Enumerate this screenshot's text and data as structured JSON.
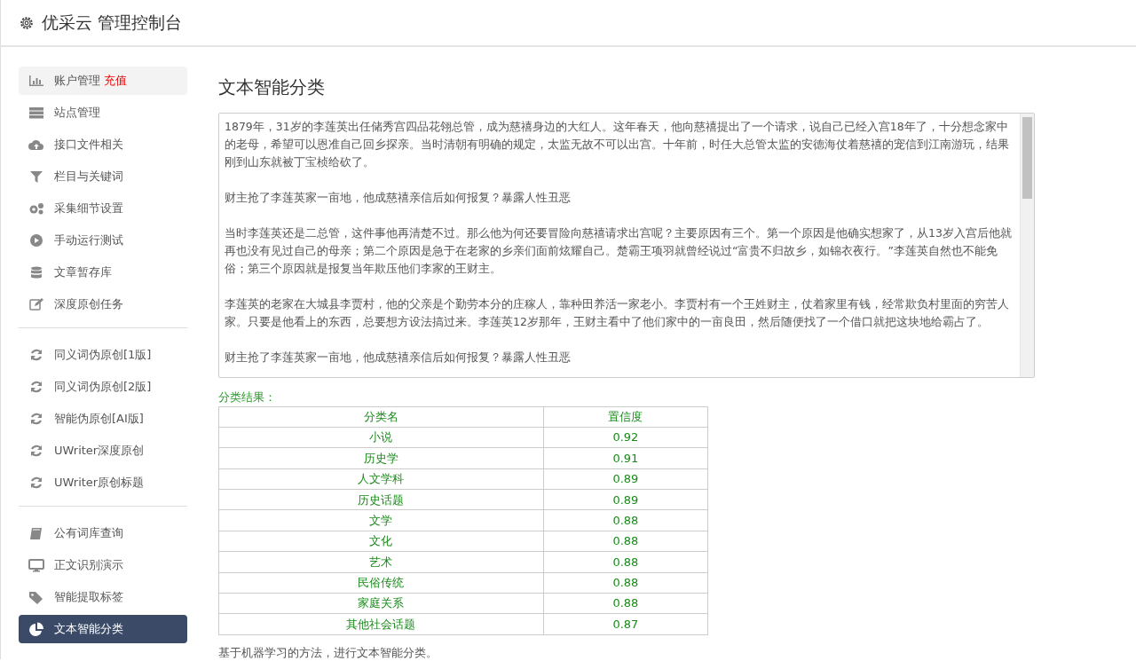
{
  "header": {
    "title": "优采云 管理控制台"
  },
  "sidebar": {
    "groups": [
      [
        {
          "label": "账户管理",
          "tag": "充值",
          "selected": false,
          "hovered": true
        },
        {
          "label": "站点管理",
          "selected": false,
          "hovered": false
        },
        {
          "label": "接口文件相关",
          "selected": false,
          "hovered": false
        },
        {
          "label": "栏目与关键词",
          "selected": false,
          "hovered": false
        },
        {
          "label": "采集细节设置",
          "selected": false,
          "hovered": false
        },
        {
          "label": "手动运行测试",
          "selected": false,
          "hovered": false
        },
        {
          "label": "文章暂存库",
          "selected": false,
          "hovered": false
        },
        {
          "label": "深度原创任务",
          "selected": false,
          "hovered": false
        }
      ],
      [
        {
          "label": "同义词伪原创[1版]",
          "selected": false,
          "hovered": false
        },
        {
          "label": "同义词伪原创[2版]",
          "selected": false,
          "hovered": false
        },
        {
          "label": "智能伪原创[AI版]",
          "selected": false,
          "hovered": false
        },
        {
          "label": "UWriter深度原创",
          "selected": false,
          "hovered": false
        },
        {
          "label": "UWriter原创标题",
          "selected": false,
          "hovered": false
        }
      ],
      [
        {
          "label": "公有词库查询",
          "selected": false,
          "hovered": false
        },
        {
          "label": "正文识别演示",
          "selected": false,
          "hovered": false
        },
        {
          "label": "智能提取标签",
          "selected": false,
          "hovered": false
        },
        {
          "label": "文本智能分类",
          "selected": true,
          "hovered": false
        }
      ]
    ]
  },
  "main": {
    "title": "文本智能分类",
    "input_text": [
      "1879年，31岁的李莲英出任储秀宫四品花翎总管，成为慈禧身边的大红人。这年春天，他向慈禧提出了一个请求，说自己已经入宫18年了，十分想念家中的老母，希望可以恩准自己回乡探亲。当时清朝有明确的规定，太监无故不可以出宫。十年前，时任大总管太监的安德海仗着慈禧的宠信到江南游玩，结果刚到山东就被丁宝桢给砍了。",
      "财主抢了李莲英家一亩地，他成慈禧亲信后如何报复？暴露人性丑恶",
      "当时李莲英还是二总管，这件事他再清楚不过。那么他为何还要冒险向慈禧请求出宫呢？主要原因有三个。第一个原因是他确实想家了，从13岁入宫后他就再也没有见过自己的母亲；第二个原因是急于在老家的乡亲们面前炫耀自己。楚霸王项羽就曾经说过“富贵不归故乡，如锦衣夜行。”李莲英自然也不能免俗；第三个原因就是报复当年欺压他们李家的王财主。",
      "李莲英的老家在大城县李贾村，他的父亲是个勤劳本分的庄稼人，靠种田养活一家老小。李贾村有一个王姓财主，仗着家里有钱，经常欺负村里面的穷苦人家。只要是他看上的东西，总要想方设法搞过来。李莲英12岁那年，王财主看中了他们家中的一亩良田，然后随便找了一个借口就把这块地给霸占了。",
      "财主抢了李莲英家一亩地，他成慈禧亲信后如何报复？暴露人性丑恶"
    ],
    "result_label": "分类结果：",
    "table": {
      "columns": [
        "分类名",
        "置信度"
      ],
      "rows": [
        [
          "小说",
          "0.92"
        ],
        [
          "历史学",
          "0.91"
        ],
        [
          "人文学科",
          "0.89"
        ],
        [
          "历史话题",
          "0.89"
        ],
        [
          "文学",
          "0.88"
        ],
        [
          "文化",
          "0.88"
        ],
        [
          "艺术",
          "0.88"
        ],
        [
          "民俗传统",
          "0.88"
        ],
        [
          "家庭关系",
          "0.88"
        ],
        [
          "其他社会话题",
          "0.87"
        ]
      ]
    },
    "footnote": "基于机器学习的方法，进行文本智能分类。"
  }
}
